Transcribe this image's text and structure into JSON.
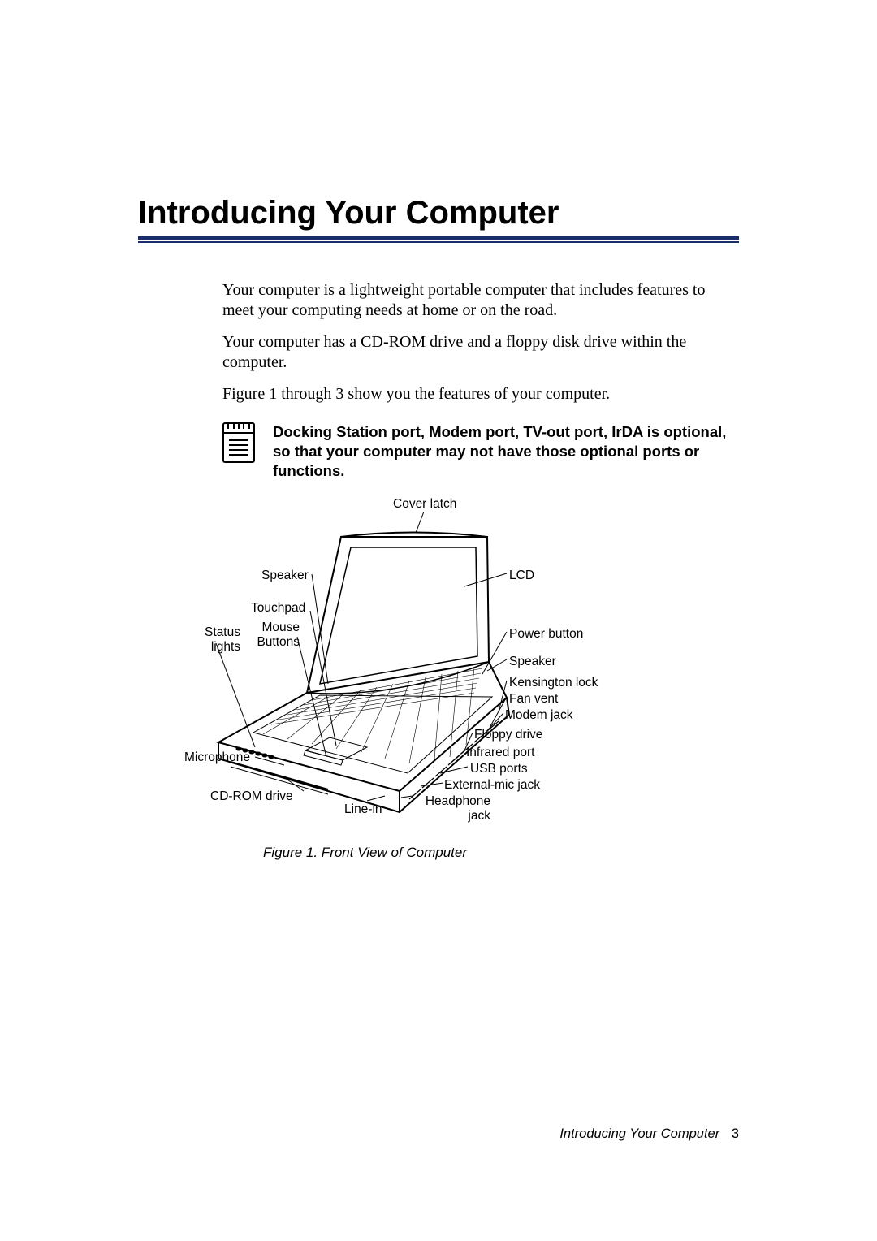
{
  "title": "Introducing Your Computer",
  "paragraphs": {
    "p1": "Your computer is a lightweight portable computer that includes features to meet your computing needs at home or on the road.",
    "p2": "Your computer has a CD-ROM drive and a floppy disk drive within the computer.",
    "p3": "Figure 1 through 3 show you the features of your computer."
  },
  "note": "Docking Station port, Modem port, TV-out port, IrDA is optional, so that your computer may not have those optional ports or functions.",
  "figure": {
    "caption": "Figure 1.  Front View of Computer",
    "labels": {
      "cover_latch": "Cover latch",
      "speaker_left": "Speaker",
      "touchpad": "Touchpad",
      "mouse_buttons": "Mouse\nButtons",
      "status_lights": "Status\nlights",
      "microphone": "Microphone",
      "cd_rom": "CD-ROM drive",
      "line_in": "Line-in",
      "headphone": "Headphone\njack",
      "external_mic": "External-mic jack",
      "usb": "USB ports",
      "infrared": "Infrared port",
      "floppy": "Floppy drive",
      "modem": "Modem jack",
      "fan": "Fan vent",
      "kensington": "Kensington lock",
      "speaker_right": "Speaker",
      "power": "Power button",
      "lcd": "LCD"
    }
  },
  "footer": {
    "section": "Introducing Your Computer",
    "page": "3"
  }
}
